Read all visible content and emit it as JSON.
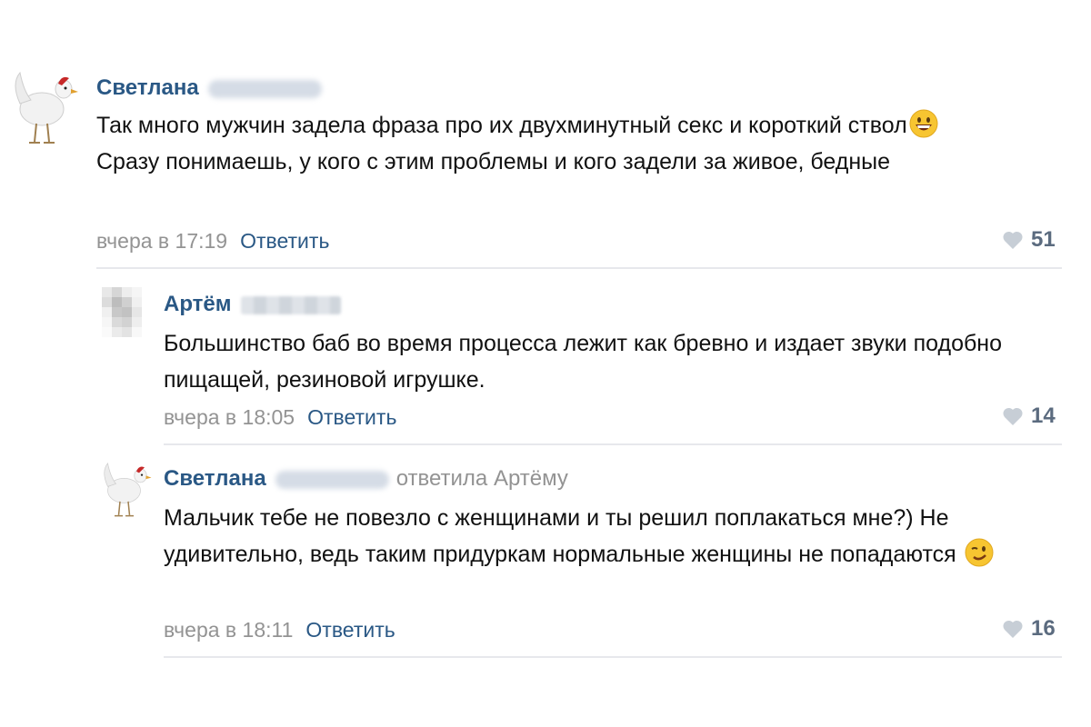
{
  "comments": [
    {
      "author": "Светлана",
      "reply_to": "",
      "text_parts": [
        "Так много мужчин задела фраза про их двухминутный секс и короткий ствол",
        "Сразу понимаешь, у кого с этим проблемы и кого задели за живое, бедные"
      ],
      "emoji": "grinning-emoji",
      "date": "вчера в 17:19",
      "reply_label": "Ответить",
      "likes": "51"
    },
    {
      "author": "Артём",
      "reply_to": "",
      "text": "Большинство баб во время процесса лежит как бревно и издает звуки подобно пищащей, резиновой игрушке.",
      "date": "вчера в 18:05",
      "reply_label": "Ответить",
      "likes": "14"
    },
    {
      "author": "Светлана",
      "reply_to": "ответила Артёму",
      "text": "Мальчик тебе не повезло с женщинами и ты решил поплакаться мне?) Не удивительно, ведь таким придуркам нормальные женщины не попадаются",
      "emoji": "winking-emoji",
      "date": "вчера в 18:11",
      "reply_label": "Ответить",
      "likes": "16"
    }
  ],
  "colors": {
    "link": "#2a5885",
    "muted": "#939393",
    "likes": "#5b6b7f",
    "divider": "#e7e8ec"
  },
  "icons": {
    "avatar": "chicken-avatar",
    "avatar_pixelated": "pixelated-avatar",
    "like": "heart-icon"
  }
}
